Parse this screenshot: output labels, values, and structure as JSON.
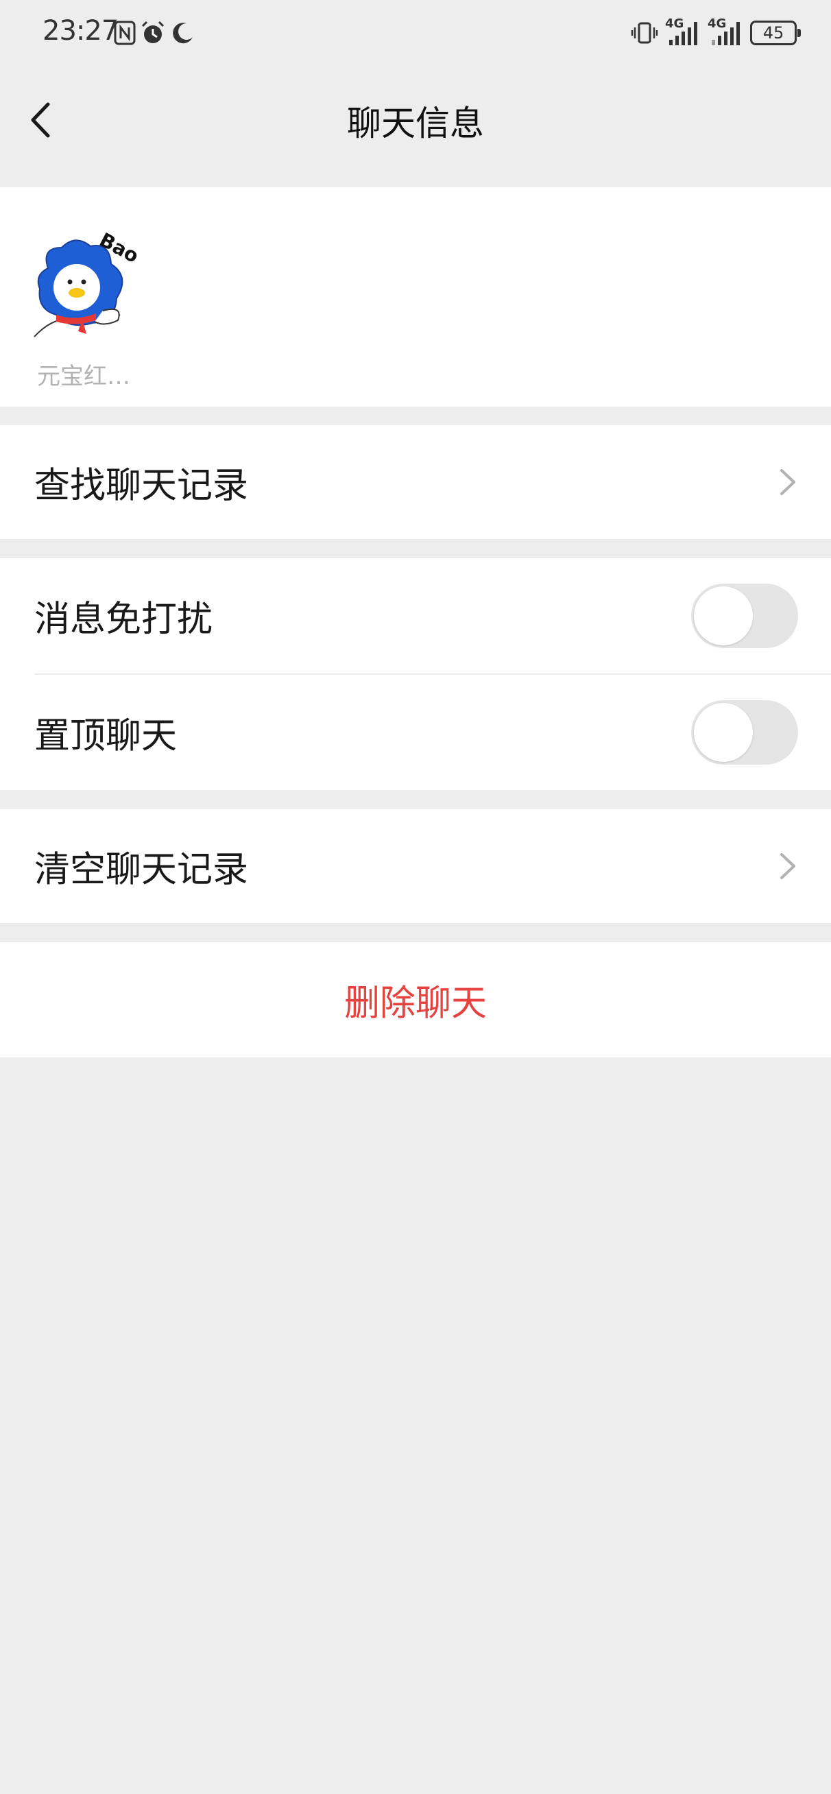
{
  "status_bar": {
    "time": "23:27",
    "left_icons": [
      "nfc-icon",
      "alarm-icon",
      "moon-icon"
    ],
    "network_1": "4G",
    "network_2": "4G",
    "battery": "45"
  },
  "nav": {
    "title": "聊天信息",
    "back_icon": "chevron-left-icon"
  },
  "members": {
    "avatar_caption": "Bao",
    "name": "元宝红…"
  },
  "rows": {
    "search_history": "查找聊天记录",
    "mute": "消息免打扰",
    "pin": "置顶聊天",
    "clear_history": "清空聊天记录",
    "delete_chat": "删除聊天"
  },
  "toggles": {
    "mute_on": false,
    "pin_on": false
  },
  "colors": {
    "background": "#ededed",
    "card": "#ffffff",
    "danger": "#e64340",
    "muted_text": "#b2b2b2"
  }
}
